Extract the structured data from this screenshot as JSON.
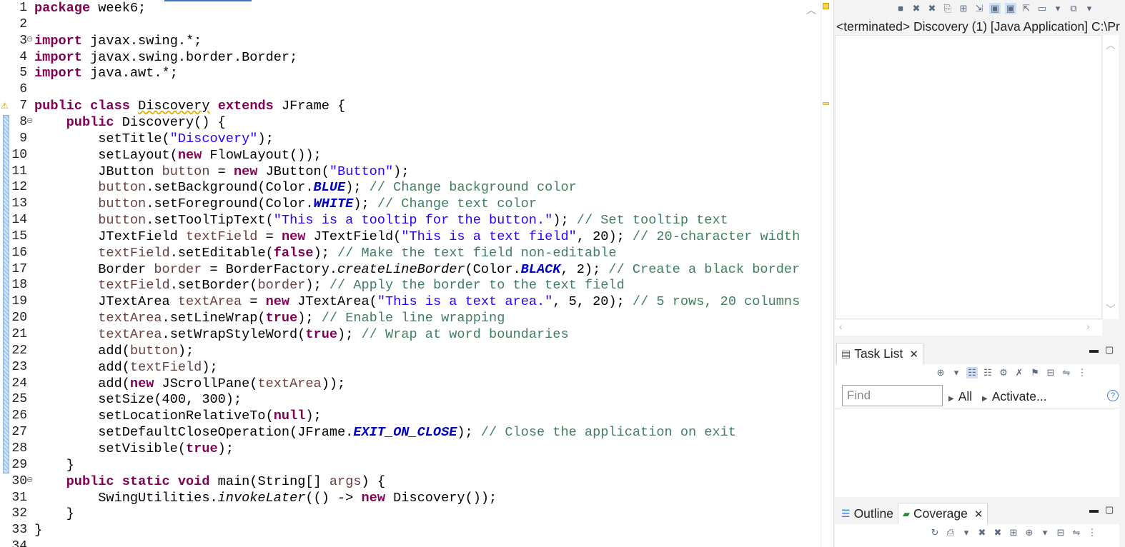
{
  "editor": {
    "lines": [
      {
        "n": "1",
        "fold": "",
        "tokens": [
          [
            "kw",
            "package"
          ],
          [
            "p",
            " week6;"
          ]
        ]
      },
      {
        "n": "2",
        "fold": "",
        "tokens": []
      },
      {
        "n": "3",
        "fold": "⊖",
        "tokens": [
          [
            "kw",
            "import"
          ],
          [
            "p",
            " javax.swing.*;"
          ]
        ]
      },
      {
        "n": "4",
        "fold": "",
        "tokens": [
          [
            "kw",
            "import"
          ],
          [
            "p",
            " javax.swing.border.Border;"
          ]
        ]
      },
      {
        "n": "5",
        "fold": "",
        "tokens": [
          [
            "kw",
            "import"
          ],
          [
            "p",
            " java.awt.*;"
          ]
        ]
      },
      {
        "n": "6",
        "fold": "",
        "tokens": []
      },
      {
        "n": "7",
        "fold": "",
        "tokens": [
          [
            "kw",
            "public class"
          ],
          [
            "p",
            " "
          ],
          [
            "warn",
            "Discovery"
          ],
          [
            "p",
            " "
          ],
          [
            "kw",
            "extends"
          ],
          [
            "p",
            " JFrame {"
          ]
        ]
      },
      {
        "n": "8",
        "fold": "⊖",
        "tokens": [
          [
            "p",
            "    "
          ],
          [
            "kw",
            "public"
          ],
          [
            "p",
            " Discovery() {"
          ]
        ]
      },
      {
        "n": "9",
        "fold": "",
        "tokens": [
          [
            "p",
            "        setTitle("
          ],
          [
            "str",
            "\"Discovery\""
          ],
          [
            "p",
            ");"
          ]
        ]
      },
      {
        "n": "10",
        "fold": "",
        "tokens": [
          [
            "p",
            "        setLayout("
          ],
          [
            "kw",
            "new"
          ],
          [
            "p",
            " FlowLayout());"
          ]
        ]
      },
      {
        "n": "11",
        "fold": "",
        "tokens": [
          [
            "p",
            "        JButton "
          ],
          [
            "var",
            "button"
          ],
          [
            "p",
            " = "
          ],
          [
            "kw",
            "new"
          ],
          [
            "p",
            " JButton("
          ],
          [
            "str",
            "\"Button\""
          ],
          [
            "p",
            ");"
          ]
        ]
      },
      {
        "n": "12",
        "fold": "",
        "tokens": [
          [
            "p",
            "        "
          ],
          [
            "var",
            "button"
          ],
          [
            "p",
            ".setBackground(Color."
          ],
          [
            "sf",
            "BLUE"
          ],
          [
            "p",
            "); "
          ],
          [
            "cm",
            "// Change background color"
          ]
        ]
      },
      {
        "n": "13",
        "fold": "",
        "tokens": [
          [
            "p",
            "        "
          ],
          [
            "var",
            "button"
          ],
          [
            "p",
            ".setForeground(Color."
          ],
          [
            "sf",
            "WHITE"
          ],
          [
            "p",
            "); "
          ],
          [
            "cm",
            "// Change text color"
          ]
        ]
      },
      {
        "n": "14",
        "fold": "",
        "tokens": [
          [
            "p",
            "        "
          ],
          [
            "var",
            "button"
          ],
          [
            "p",
            ".setToolTipText("
          ],
          [
            "str",
            "\"This is a tooltip for the button.\""
          ],
          [
            "p",
            "); "
          ],
          [
            "cm",
            "// Set tooltip text"
          ]
        ]
      },
      {
        "n": "15",
        "fold": "",
        "tokens": [
          [
            "p",
            "        JTextField "
          ],
          [
            "var",
            "textField"
          ],
          [
            "p",
            " = "
          ],
          [
            "kw",
            "new"
          ],
          [
            "p",
            " JTextField("
          ],
          [
            "str",
            "\"This is a text field\""
          ],
          [
            "p",
            ", 20); "
          ],
          [
            "cm",
            "// 20-character width"
          ]
        ]
      },
      {
        "n": "16",
        "fold": "",
        "tokens": [
          [
            "p",
            "        "
          ],
          [
            "var",
            "textField"
          ],
          [
            "p",
            ".setEditable("
          ],
          [
            "kw",
            "false"
          ],
          [
            "p",
            "); "
          ],
          [
            "cm",
            "// Make the text field non-editable"
          ]
        ]
      },
      {
        "n": "17",
        "fold": "",
        "tokens": [
          [
            "p",
            "        Border "
          ],
          [
            "var",
            "border"
          ],
          [
            "p",
            " = BorderFactory."
          ],
          [
            "sm",
            "createLineBorder"
          ],
          [
            "p",
            "(Color."
          ],
          [
            "sf",
            "BLACK"
          ],
          [
            "p",
            ", 2); "
          ],
          [
            "cm",
            "// Create a black border"
          ]
        ]
      },
      {
        "n": "18",
        "fold": "",
        "tokens": [
          [
            "p",
            "        "
          ],
          [
            "var",
            "textField"
          ],
          [
            "p",
            ".setBorder("
          ],
          [
            "var",
            "border"
          ],
          [
            "p",
            "); "
          ],
          [
            "cm",
            "// Apply the border to the text field"
          ]
        ]
      },
      {
        "n": "19",
        "fold": "",
        "tokens": [
          [
            "p",
            "        JTextArea "
          ],
          [
            "var",
            "textArea"
          ],
          [
            "p",
            " = "
          ],
          [
            "kw",
            "new"
          ],
          [
            "p",
            " JTextArea("
          ],
          [
            "str",
            "\"This is a text area.\""
          ],
          [
            "p",
            ", 5, 20); "
          ],
          [
            "cm",
            "// 5 rows, 20 columns"
          ]
        ]
      },
      {
        "n": "20",
        "fold": "",
        "tokens": [
          [
            "p",
            "        "
          ],
          [
            "var",
            "textArea"
          ],
          [
            "p",
            ".setLineWrap("
          ],
          [
            "kw",
            "true"
          ],
          [
            "p",
            "); "
          ],
          [
            "cm",
            "// Enable line wrapping"
          ]
        ]
      },
      {
        "n": "21",
        "fold": "",
        "tokens": [
          [
            "p",
            "        "
          ],
          [
            "var",
            "textArea"
          ],
          [
            "p",
            ".setWrapStyleWord("
          ],
          [
            "kw",
            "true"
          ],
          [
            "p",
            "); "
          ],
          [
            "cm",
            "// Wrap at word boundaries"
          ]
        ]
      },
      {
        "n": "22",
        "fold": "",
        "tokens": [
          [
            "p",
            "        add("
          ],
          [
            "var",
            "button"
          ],
          [
            "p",
            ");"
          ]
        ]
      },
      {
        "n": "23",
        "fold": "",
        "tokens": [
          [
            "p",
            "        add("
          ],
          [
            "var",
            "textField"
          ],
          [
            "p",
            ");"
          ]
        ]
      },
      {
        "n": "24",
        "fold": "",
        "tokens": [
          [
            "p",
            "        add("
          ],
          [
            "kw",
            "new"
          ],
          [
            "p",
            " JScrollPane("
          ],
          [
            "var",
            "textArea"
          ],
          [
            "p",
            "));"
          ]
        ]
      },
      {
        "n": "25",
        "fold": "",
        "tokens": [
          [
            "p",
            "        setSize(400, 300);"
          ]
        ]
      },
      {
        "n": "26",
        "fold": "",
        "tokens": [
          [
            "p",
            "        setLocationRelativeTo("
          ],
          [
            "kw",
            "null"
          ],
          [
            "p",
            ");"
          ]
        ]
      },
      {
        "n": "27",
        "fold": "",
        "tokens": [
          [
            "p",
            "        setDefaultCloseOperation(JFrame."
          ],
          [
            "sf",
            "EXIT_ON_CLOSE"
          ],
          [
            "p",
            "); "
          ],
          [
            "cm",
            "// Close the application on exit"
          ]
        ]
      },
      {
        "n": "28",
        "fold": "",
        "tokens": [
          [
            "p",
            "        setVisible("
          ],
          [
            "kw",
            "true"
          ],
          [
            "p",
            ");"
          ]
        ]
      },
      {
        "n": "29",
        "fold": "",
        "tokens": [
          [
            "p",
            "    }"
          ]
        ]
      },
      {
        "n": "30",
        "fold": "⊖",
        "tokens": [
          [
            "p",
            "    "
          ],
          [
            "kw",
            "public static void"
          ],
          [
            "p",
            " main(String[] "
          ],
          [
            "var",
            "args"
          ],
          [
            "p",
            ") {"
          ]
        ]
      },
      {
        "n": "31",
        "fold": "",
        "tokens": [
          [
            "p",
            "        SwingUtilities."
          ],
          [
            "sm",
            "invokeLater"
          ],
          [
            "p",
            "(() -> "
          ],
          [
            "kw",
            "new"
          ],
          [
            "p",
            " Discovery());"
          ]
        ]
      },
      {
        "n": "32",
        "fold": "",
        "tokens": [
          [
            "p",
            "    }"
          ]
        ]
      },
      {
        "n": "33",
        "fold": "",
        "tokens": [
          [
            "p",
            "}"
          ]
        ]
      },
      {
        "n": "34",
        "fold": "",
        "tokens": []
      }
    ]
  },
  "console": {
    "label": "<terminated> Discovery (1) [Java Application] C:\\Pr"
  },
  "task_list": {
    "tab_label": "Task List",
    "find_placeholder": "Find",
    "filter_all": "All",
    "filter_activate": "Activate..."
  },
  "bottom_tabs": {
    "outline_label": "Outline",
    "coverage_label": "Coverage"
  }
}
